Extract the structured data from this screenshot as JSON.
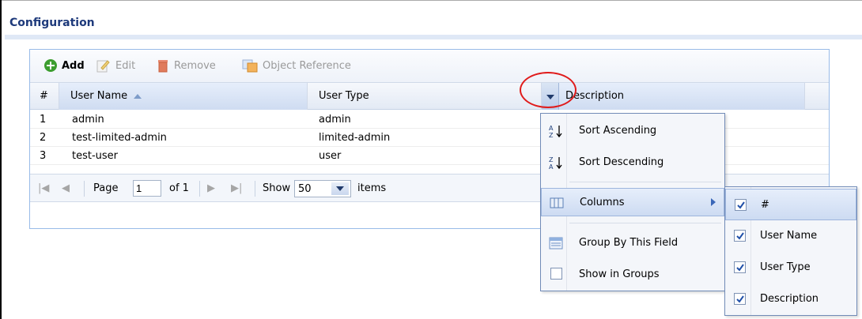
{
  "header": {
    "title": "Configuration"
  },
  "toolbar": {
    "add": "Add",
    "edit": "Edit",
    "remove": "Remove",
    "object_reference": "Object Reference"
  },
  "table": {
    "columns": [
      "#",
      "User Name",
      "User Type",
      "Description"
    ],
    "rows": [
      {
        "num": "1",
        "name": "admin",
        "type": "admin"
      },
      {
        "num": "2",
        "name": "test-limited-admin",
        "type": "limited-admin"
      },
      {
        "num": "3",
        "name": "test-user",
        "type": "user"
      }
    ]
  },
  "pager": {
    "page_label": "Page",
    "page_value": "1",
    "of_label": "of 1",
    "show_label": "Show",
    "show_value": "50",
    "items_label": "items"
  },
  "column_menu": {
    "sort_asc": "Sort Ascending",
    "sort_desc": "Sort Descending",
    "columns": "Columns",
    "group_by": "Group By This Field",
    "show_groups": "Show in Groups"
  },
  "columns_submenu": [
    {
      "label": "#",
      "checked": true
    },
    {
      "label": "User Name",
      "checked": true
    },
    {
      "label": "User Type",
      "checked": true
    },
    {
      "label": "Description",
      "checked": true
    }
  ],
  "colors": {
    "title": "#1e3a7b",
    "highlight_circle": "#e01b1b",
    "add_green": "#3c9d2f"
  }
}
